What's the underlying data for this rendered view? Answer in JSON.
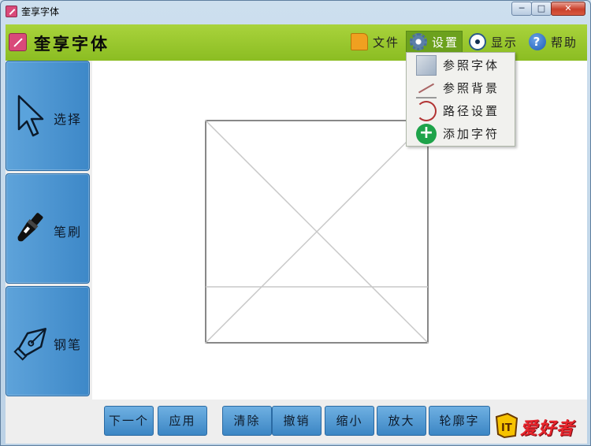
{
  "window": {
    "title": "奎享字体",
    "controls": {
      "minimize": "─",
      "maximize": "□",
      "close": "✕"
    }
  },
  "header": {
    "app_title": "奎享字体",
    "menu": [
      {
        "label": "文件",
        "icon": "folder-icon"
      },
      {
        "label": "设置",
        "icon": "gear-icon"
      },
      {
        "label": "显示",
        "icon": "eye-icon"
      },
      {
        "label": "帮助",
        "icon": "help-icon"
      }
    ]
  },
  "settings_menu": {
    "items": [
      {
        "label": "参照字体",
        "icon": "reference-font-icon"
      },
      {
        "label": "参照背景",
        "icon": "reference-background-icon"
      },
      {
        "label": "路径设置",
        "icon": "path-settings-icon"
      },
      {
        "label": "添加字符",
        "icon": "add-icon"
      }
    ]
  },
  "tools": [
    {
      "label": "选择",
      "icon": "cursor-icon"
    },
    {
      "label": "笔刷",
      "icon": "brush-icon"
    },
    {
      "label": "钢笔",
      "icon": "pen-nib-icon"
    }
  ],
  "actions": [
    {
      "label": "下一个"
    },
    {
      "label": "应用"
    },
    {
      "label": "清除"
    },
    {
      "label": "撤销"
    },
    {
      "label": "缩小"
    },
    {
      "label": "放大"
    },
    {
      "label": "轮廓字"
    }
  ],
  "watermark": {
    "text": "爱好者",
    "badge": "IT"
  },
  "colors": {
    "header_green": "#9bc92f",
    "tool_blue": "#4a92cf",
    "active_menu": "#6ca11d"
  }
}
